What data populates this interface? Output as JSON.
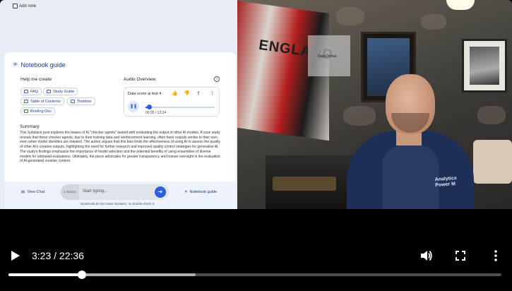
{
  "screen_share": {
    "add_note": "Add note",
    "notebook_guide": {
      "title": "Notebook guide",
      "help_title": "Help me create",
      "chips": [
        "FAQ",
        "Study Guide",
        "Table of Contents",
        "Timeline",
        "Briefing Doc"
      ],
      "audio_overview": {
        "title": "Audio Overview",
        "name": "Data score ai test 4",
        "time": "00:35 / 12:24",
        "progress_fraction": 0.047
      },
      "summary_title": "Summary",
      "summary_text": "This Substack post explores the biases of AI \"checker agents\" tasked with evaluating the output of other AI models. A case study reveals that these checker agents, due to their training data and reinforcement learning, often favor outputs similar to their own, even when model identities are masked. The author argues that this bias limits the effectiveness of using AI to assess the quality of other AI's creative outputs, highlighting the need for further research and improved quality control strategies for generative AI. The study's findings emphasize the importance of model selection and the potential benefits of using ensembles of diverse models for unbiased evaluations. Ultimately, the piece advocates for greater transparency and human oversight in the evaluation of AI-generated creative content."
    },
    "chat_bar": {
      "view_chat": "View Chat",
      "source_count": "1 source",
      "placeholder": "Start typing...",
      "notebook_guide": "Notebook guide",
      "disclaimer": "NotebookLM can make mistakes, so double-check it."
    }
  },
  "webcam": {
    "label": "DataChorus",
    "banner_text": "ENGLAND",
    "shirt_text_line1": "Analytics",
    "shirt_text_line2": "Power M"
  },
  "player": {
    "time_display": "3:23 / 22:36",
    "played_fraction": 0.1497,
    "buffered_fraction": 0.38,
    "icons": {
      "play": "play-icon",
      "volume": "volume-icon",
      "fullscreen": "fullscreen-icon",
      "more": "more-vert-icon"
    }
  }
}
